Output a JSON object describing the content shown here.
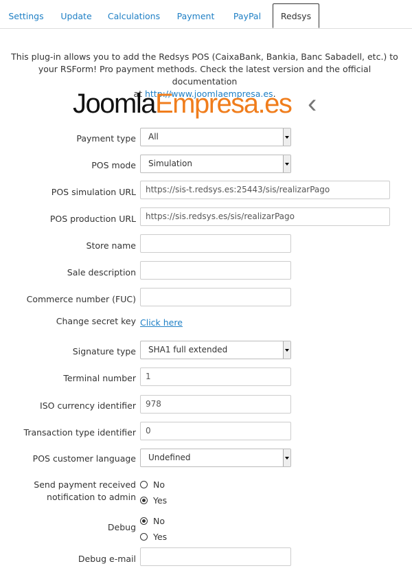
{
  "tabs": [
    "Settings",
    "Update",
    "Calculations",
    "Payment",
    "PayPal",
    "Redsys"
  ],
  "active_tab": "Redsys",
  "intro": {
    "line1": "This plug-in allows you to add the Redsys POS (CaixaBank, Bankia, Banc Sabadell, etc.) to",
    "line2": "your RSForm! Pro payment methods. Check the latest version and the official documentation",
    "line3_prefix": "at",
    "link": "http://www.joomlaempresa.es",
    "line3_suffix": "."
  },
  "logo": {
    "part1": "Joomla",
    "part2": "Empresa",
    "part3": ".es",
    "chevron": "‹"
  },
  "form": {
    "payment_type": {
      "label": "Payment type",
      "value": "All"
    },
    "pos_mode": {
      "label": "POS mode",
      "value": "Simulation"
    },
    "pos_simulation_url": {
      "label": "POS simulation URL",
      "value": "https://sis-t.redsys.es:25443/sis/realizarPago"
    },
    "pos_production_url": {
      "label": "POS production URL",
      "value": "https://sis.redsys.es/sis/realizarPago"
    },
    "store_name": {
      "label": "Store name",
      "value": ""
    },
    "sale_description": {
      "label": "Sale description",
      "value": ""
    },
    "commerce_number": {
      "label": "Commerce number (FUC)",
      "value": ""
    },
    "change_secret_key": {
      "label": "Change secret key",
      "link": "Click here"
    },
    "signature_type": {
      "label": "Signature type",
      "value": "SHA1 full extended"
    },
    "terminal_number": {
      "label": "Terminal number",
      "value": "1"
    },
    "iso_currency": {
      "label": "ISO currency identifier",
      "value": "978"
    },
    "transaction_type": {
      "label": "Transaction type identifier",
      "value": "0"
    },
    "pos_language": {
      "label": "POS customer language",
      "value": "Undefined"
    },
    "send_notification": {
      "label_line1": "Send payment received",
      "label_line2": "notification to admin",
      "options": [
        "No",
        "Yes"
      ],
      "selected": "Yes"
    },
    "debug": {
      "label": "Debug",
      "options": [
        "No",
        "Yes"
      ],
      "selected": "No"
    },
    "debug_email": {
      "label": "Debug e-mail",
      "value": ""
    }
  }
}
